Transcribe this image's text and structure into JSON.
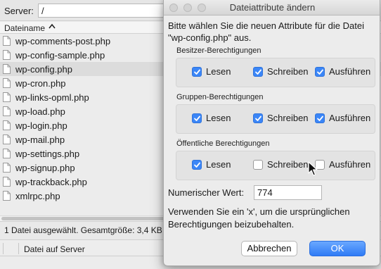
{
  "server": {
    "label": "Server:",
    "path": "/"
  },
  "file_list": {
    "column_name": "Dateiname",
    "files": [
      "wp-comments-post.php",
      "wp-config-sample.php",
      "wp-config.php",
      "wp-cron.php",
      "wp-links-opml.php",
      "wp-load.php",
      "wp-login.php",
      "wp-mail.php",
      "wp-settings.php",
      "wp-signup.php",
      "wp-trackback.php",
      "xmlrpc.php"
    ],
    "selected_index": 2
  },
  "status": {
    "text": "1 Datei ausgewählt. Gesamtgröße: 3,4 KB"
  },
  "queue": {
    "column": "Datei auf Server"
  },
  "dialog": {
    "title": "Dateiattribute ändern",
    "prompt": "Bitte wählen Sie die neuen Attribute für die Datei \"wp-config.php\" aus.",
    "groups": [
      {
        "label": "Besitzer-Berechtigungen",
        "perms": [
          {
            "label": "Lesen",
            "checked": true
          },
          {
            "label": "Schreiben",
            "checked": true
          },
          {
            "label": "Ausführen",
            "checked": true
          }
        ]
      },
      {
        "label": "Gruppen-Berechtigungen",
        "perms": [
          {
            "label": "Lesen",
            "checked": true
          },
          {
            "label": "Schreiben",
            "checked": true
          },
          {
            "label": "Ausführen",
            "checked": true
          }
        ]
      },
      {
        "label": "Öffentliche Berechtigungen",
        "perms": [
          {
            "label": "Lesen",
            "checked": true
          },
          {
            "label": "Schreiben",
            "checked": false
          },
          {
            "label": "Ausführen",
            "checked": false
          }
        ]
      }
    ],
    "numeric_label": "Numerischer Wert:",
    "numeric_value": "774",
    "hint": "Verwenden Sie ein 'x', um die ursprünglichen Berechtigungen beizubehalten.",
    "cancel_label": "Abbrechen",
    "ok_label": "OK"
  },
  "colors": {
    "accent": "#3b86f7",
    "selected_row": "#dcdcdc",
    "dialog_bg": "#ececec"
  }
}
